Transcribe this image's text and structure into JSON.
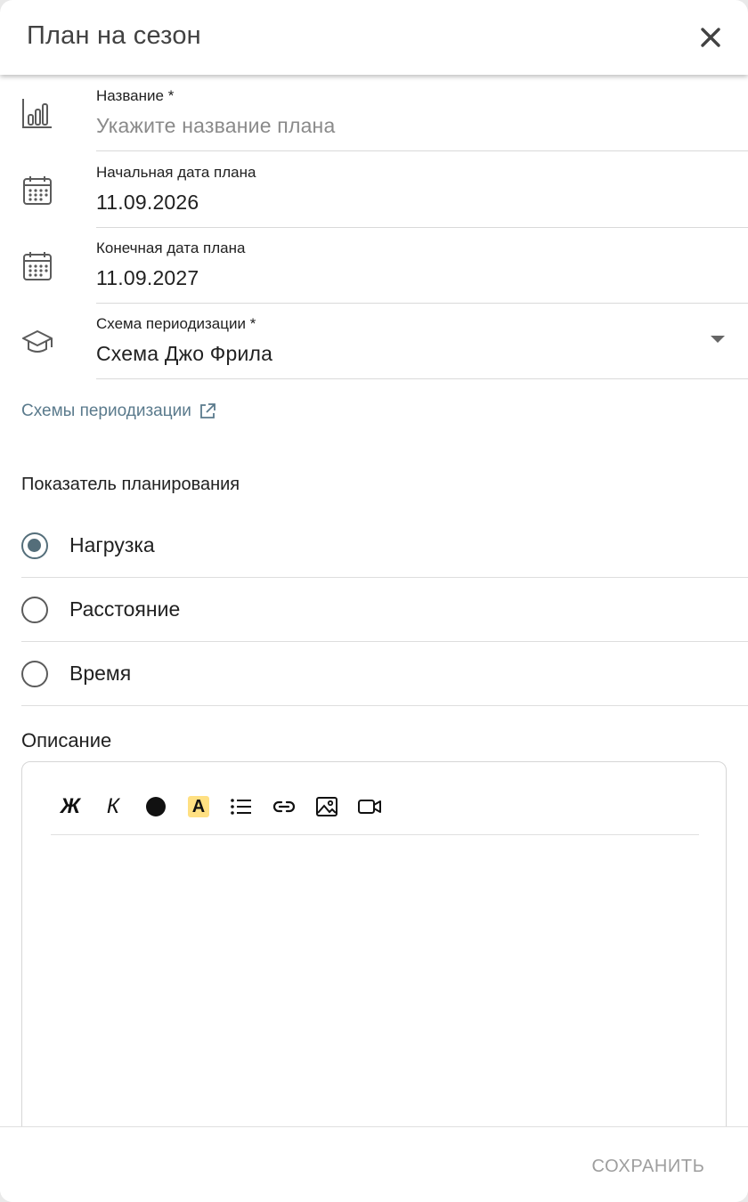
{
  "dialog": {
    "title": "План на сезон"
  },
  "fields": {
    "name": {
      "label": "Название *",
      "placeholder": "Укажите название плана"
    },
    "start_date": {
      "label": "Начальная дата плана",
      "value": "11.09.2026"
    },
    "end_date": {
      "label": "Конечная дата плана",
      "value": "11.09.2027"
    },
    "scheme": {
      "label": "Схема периодизации *",
      "value": "Схема Джо Фрила"
    }
  },
  "scheme_link": {
    "label": "Схемы периодизации",
    "icon": "external-link-icon"
  },
  "planning": {
    "title": "Показатель планирования",
    "options": [
      {
        "label": "Нагрузка",
        "checked": true
      },
      {
        "label": "Расстояние",
        "checked": false
      },
      {
        "label": "Время",
        "checked": false
      }
    ]
  },
  "description": {
    "title": "Описание",
    "toolbar": {
      "bold": "Ж",
      "italic": "К",
      "highlight": "A"
    }
  },
  "footer": {
    "save_label": "СОХРАНИТЬ"
  },
  "colors": {
    "accent": "#546e7a",
    "link": "#5a7a8c",
    "highlight": "#ffe082",
    "disabled_text": "#9e9e9e"
  }
}
